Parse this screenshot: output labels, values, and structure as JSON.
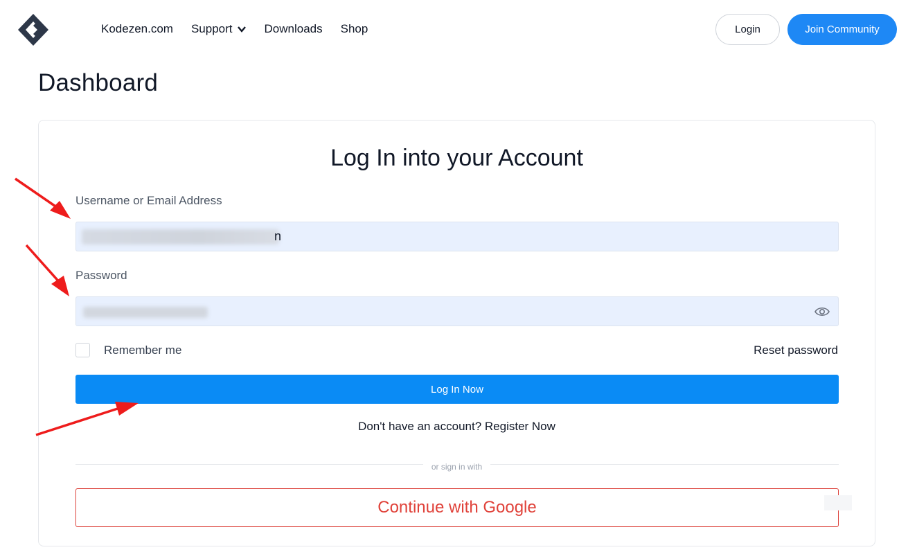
{
  "nav": {
    "links": [
      "Kodezen.com",
      "Support",
      "Downloads",
      "Shop"
    ],
    "login_label": "Login",
    "join_label": "Join Community"
  },
  "page": {
    "title": "Dashboard"
  },
  "form": {
    "title": "Log In into your Account",
    "username_label": "Username or Email Address",
    "username_visible_tail": "n",
    "password_label": "Password",
    "remember_label": "Remember me",
    "reset_label": "Reset password",
    "submit_label": "Log In Now",
    "register_text": "Don't have an account? Register Now",
    "divider_text": "or sign in with",
    "google_label": "Continue with Google"
  },
  "icons": {
    "logo": "kodezen-logo-icon",
    "support_chevron": "chevron-down-icon",
    "password_toggle": "eye-icon"
  },
  "colors": {
    "primary": "#0a8bf5",
    "join_button": "#1e88f5",
    "google": "#e0423a",
    "input_bg": "#e8f0fe",
    "annotation_arrow": "#ee1c1c"
  }
}
